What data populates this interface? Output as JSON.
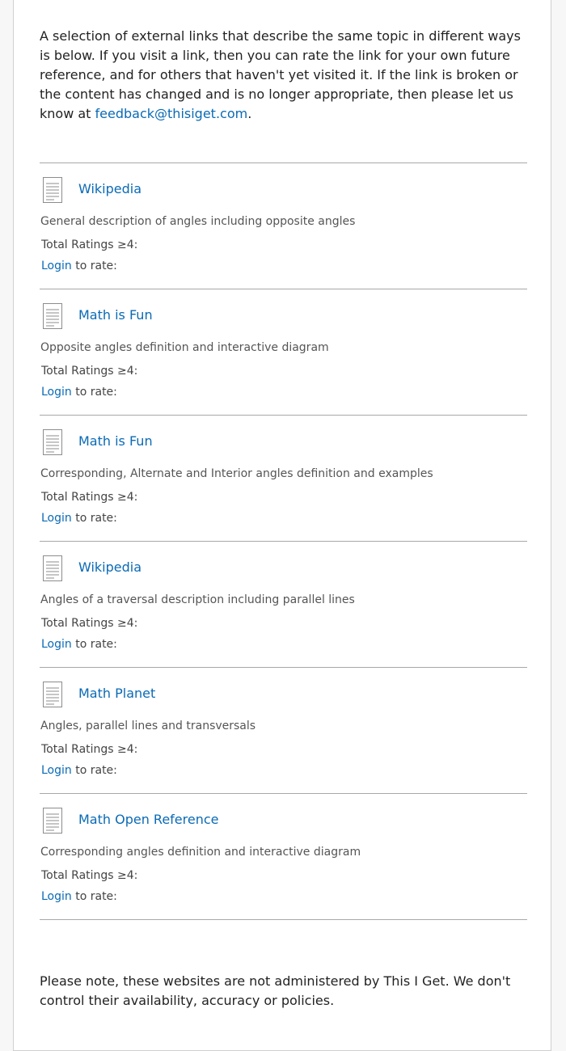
{
  "intro": {
    "text": "A selection of external links that describe the same topic in different ways is below. If you visit a link, then you can rate the link for your own future reference, and for others that haven't yet visited it. If the link is broken or the content has changed and is no longer appropriate, then please let us know at ",
    "email": "feedback@thisiget.com",
    "suffix": "."
  },
  "links": [
    {
      "title": "Wikipedia",
      "description": "General description of angles including opposite angles",
      "ratings_label": "Total Ratings ≥4:",
      "login_label": "Login",
      "rate_suffix": " to rate:"
    },
    {
      "title": "Math is Fun",
      "description": "Opposite angles definition and interactive diagram",
      "ratings_label": "Total Ratings ≥4:",
      "login_label": "Login",
      "rate_suffix": " to rate:"
    },
    {
      "title": "Math is Fun",
      "description": "Corresponding, Alternate and Interior angles definition and examples",
      "ratings_label": "Total Ratings ≥4:",
      "login_label": "Login",
      "rate_suffix": " to rate:"
    },
    {
      "title": "Wikipedia",
      "description": "Angles of a traversal description including parallel lines",
      "ratings_label": "Total Ratings ≥4:",
      "login_label": "Login",
      "rate_suffix": " to rate:"
    },
    {
      "title": "Math Planet",
      "description": "Angles, parallel lines and transversals",
      "ratings_label": "Total Ratings ≥4:",
      "login_label": "Login",
      "rate_suffix": " to rate:"
    },
    {
      "title": "Math Open Reference",
      "description": "Corresponding angles definition and interactive diagram",
      "ratings_label": "Total Ratings ≥4:",
      "login_label": "Login",
      "rate_suffix": " to rate:"
    }
  ],
  "footer": {
    "note": "Please note, these websites are not administered by This I Get. We don't control their availability, accuracy or policies."
  },
  "icons": {
    "link_icon": "document-icon"
  },
  "colors": {
    "link": "#0a6ab5",
    "text": "#222222",
    "muted": "#555555",
    "divider": "#a8a8a8"
  }
}
